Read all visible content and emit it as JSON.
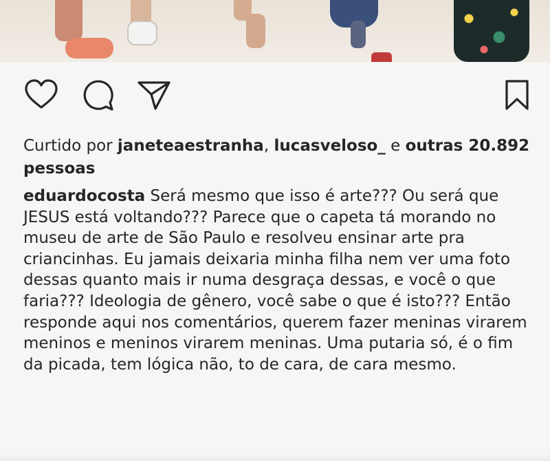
{
  "post": {
    "actions": {
      "like_icon": "heart-icon",
      "comment_icon": "comment-icon",
      "share_icon": "send-icon",
      "save_icon": "bookmark-icon"
    },
    "likes": {
      "prefix": "Curtido por ",
      "user1": "janeteaestranha",
      "separator": ", ",
      "user2": "lucasveloso_",
      "conjunction": " e ",
      "others": "outras 20.892 pessoas"
    },
    "caption": {
      "username": "eduardocosta",
      "text": "Será mesmo que isso é arte??? Ou será que JESUS está voltando??? Parece que o capeta tá morando no museu  de arte de São Paulo e resolveu ensinar arte pra criancinhas. Eu jamais deixaria minha filha nem ver uma foto dessas quanto mais ir numa desgraça dessas, e você o que faria??? Ideologia de gênero, você sabe o que é isto??? Então responde aqui nos comentários, querem fazer meninas virarem meninos e meninos virarem meninas. Uma putaria só, é o fim da picada, tem lógica não, to de cara, de cara mesmo."
    }
  }
}
